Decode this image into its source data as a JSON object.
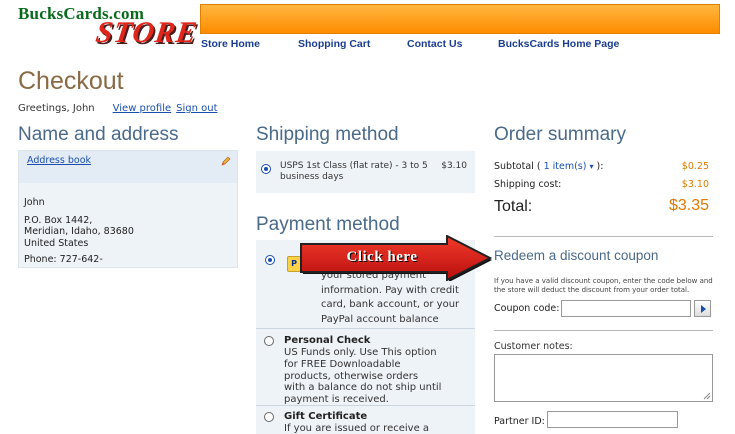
{
  "header": {
    "logo_top": "BucksCards.com",
    "logo_store": "STORE",
    "nav": [
      "Store Home",
      "Shopping Cart",
      "Contact Us",
      "BucksCards Home Page"
    ]
  },
  "page_title": "Checkout",
  "greeting": {
    "text": "Greetings, John",
    "view_profile": "View profile",
    "sign_out": "Sign out"
  },
  "name_address": {
    "title": "Name and address",
    "address_book": "Address book",
    "lines": [
      "John",
      "P.O. Box 1442,",
      "Meridian, Idaho, 83680",
      "United States"
    ],
    "phone": "Phone: 727-642-"
  },
  "shipping": {
    "title": "Shipping method",
    "option": "USPS 1st Class (flat rate) - 3 to 5 business days",
    "price": "$3.10"
  },
  "payment": {
    "title": "Payment method",
    "paypal_desc": [
      "your stored payment",
      "information. Pay with credit",
      "card, bank account, or your",
      "PayPal account balance"
    ],
    "check_title": "Personal Check",
    "check_desc": [
      "US Funds only. Use This option",
      "for FREE Downloadable",
      "products, otherwise orders",
      "with a balance do not ship until",
      "payment is received."
    ],
    "gift_title": "Gift Certificate",
    "gift_desc": "If you are issued or receive a"
  },
  "summary": {
    "title": "Order summary",
    "subtotal_label": "Subtotal (",
    "items_link": "1 item(s)",
    "subtotal_suffix": "):",
    "subtotal_value": "$0.25",
    "shipping_label": "Shipping cost:",
    "shipping_value": "$3.10",
    "total_label": "Total:",
    "total_value": "$3.35"
  },
  "coupon": {
    "title": "Redeem a discount coupon",
    "help": "If you have a valid discount coupon, enter the code below and the store will deduct the discount from your order total.",
    "label": "Coupon code:"
  },
  "notes": {
    "label": "Customer notes:"
  },
  "partner": {
    "label": "Partner ID:"
  },
  "callout": {
    "text": "Click here"
  },
  "colors": {
    "accent_orange": "#ff9a1a",
    "link_blue": "#1a4fb0",
    "price_orange": "#e07b00",
    "callout_red": "#d81e1e"
  }
}
